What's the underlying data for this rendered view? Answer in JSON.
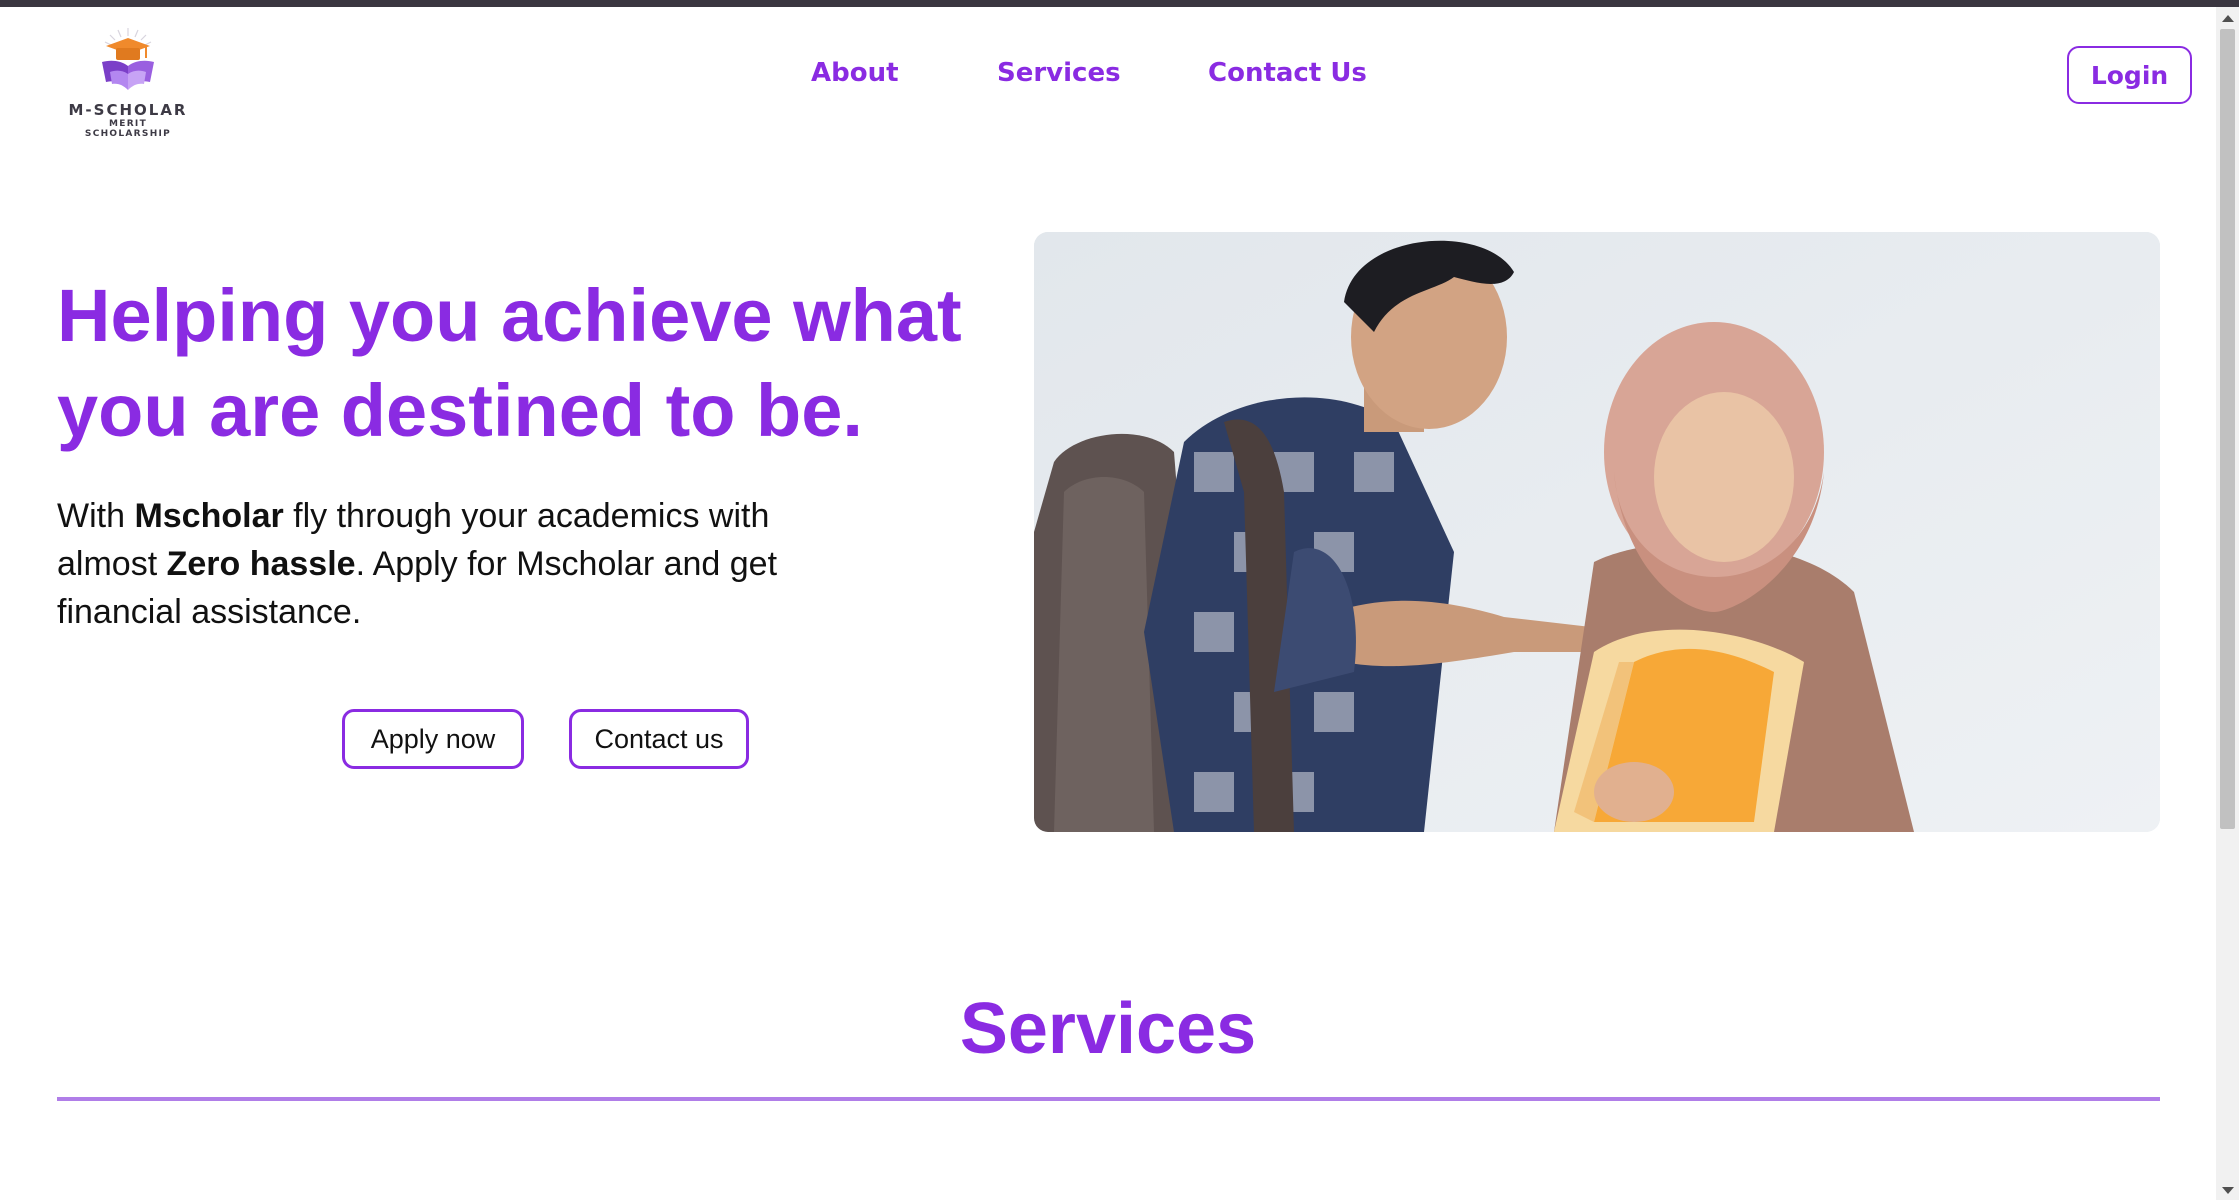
{
  "header": {
    "logo_title": "M-SCHOLAR",
    "logo_subtitle": "MERIT SCHOLARSHIP",
    "nav": [
      {
        "label": "About"
      },
      {
        "label": "Services"
      },
      {
        "label": "Contact Us"
      }
    ],
    "login_label": "Login"
  },
  "hero": {
    "title_line1": "Helping you achieve what",
    "title_line2": "you are destined to be.",
    "desc": {
      "p1": "With ",
      "b1": "Mscholar",
      "p2": " fly through your academics with almost ",
      "b2": "Zero hassle",
      "p3": ". Apply for Mscholar and get financial assistance."
    },
    "apply_label": "Apply now",
    "contact_label": "Contact us"
  },
  "services": {
    "heading": "Services"
  },
  "colors": {
    "accent": "#8a2be2",
    "divider": "#b07ee8",
    "logo_orange": "#f08a2c",
    "logo_purple": "#7b3fc8"
  }
}
